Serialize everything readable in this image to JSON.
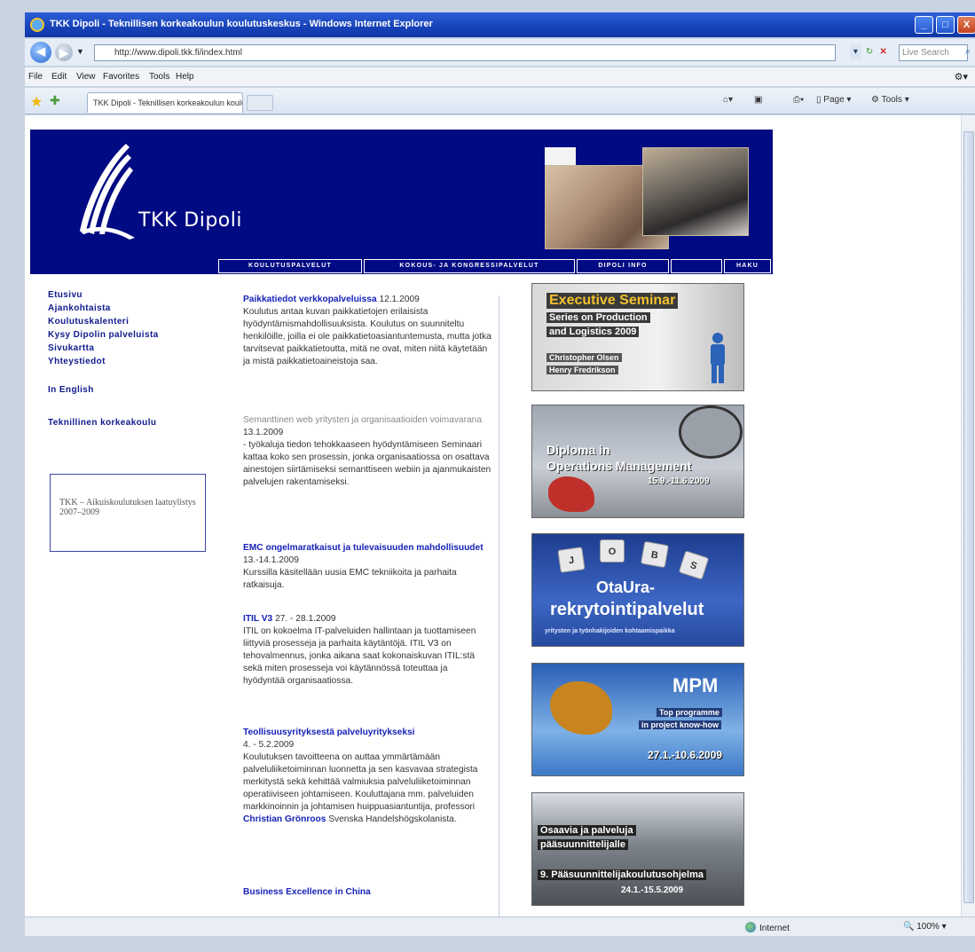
{
  "browser": {
    "window_title": "TKK Dipoli - Teknillisen korkeakoulun koulutuskeskus - Windows Internet Explorer",
    "address": "http://www.dipoli.tkk.fi/index.html",
    "search_placeholder": "Live Search",
    "menu": [
      "File",
      "Edit",
      "View",
      "Favorites",
      "Tools",
      "Help"
    ],
    "tab_title": "TKK Dipoli - Teknillisen korkeakoulun koulutuskeskus",
    "commands": {
      "page": "Page",
      "tools": "Tools"
    },
    "status": {
      "zone": "Internet",
      "zoom": "100%"
    },
    "window_buttons": {
      "min": "_",
      "max": "□",
      "close": "X"
    }
  },
  "site": {
    "logo_text": "TKK Dipoli",
    "nav": [
      "KOULUTUSPALVELUT",
      "KOKOUS- JA KONGRESSIPALVELUT",
      "DIPOLI INFO",
      "",
      "HAKU"
    ],
    "left_links": [
      "Etusivu",
      "Ajankohtaista",
      "Koulutuskalenteri",
      "Kysy Dipolin palveluista",
      "Sivukartta",
      "Yhteystiedot"
    ],
    "english_link": "In English",
    "tkk_link": "Teknillinen korkeakoulu",
    "promo": "TKK – Aikuiskoulutuksen laatuylistys 2007–2009"
  },
  "news": [
    {
      "title": "Paikkatiedot verkkopalveluissa",
      "date": "12.1.2009",
      "body": "Koulutus antaa kuvan paikkatietojen erilaisista hyödyntämismahdollisuuksista. Koulutus on suunniteltu henkilöille, joilla ei ole paikkatietoasiantuntemusta, mutta jotka tarvitsevat paikkatietoutta, mitä ne ovat, miten niitä käytetään ja mistä paikkatietoaineistoja saa."
    },
    {
      "title": "Semanttinen web yritysten ja organisaatioiden voimavarana",
      "date": "13.1.2009",
      "body": "- työkaluja tiedon tehokkaaseen hyödyntämiseen Seminaari kattaa koko sen prosessin, jonka organisaatiossa on osattava ainestojen siirtämiseksi semanttiseen webiin ja ajanmukaisten palvelujen rakentamiseksi."
    },
    {
      "title": "EMC ongelmaratkaisut ja tulevaisuuden mahdollisuudet",
      "date": "13.-14.1.2009",
      "body": "Kurssilla käsitellään uusia EMC tekniikoita ja parhaita ratkaisuja."
    },
    {
      "title": "ITIL V3",
      "date": "27. - 28.1.2009",
      "body": "ITIL on kokoelma IT-palveluiden hallintaan ja tuottamiseen liittyviä prosesseja ja parhaita käytäntöjä. ITIL V3 on tehovalmennus, jonka aikana saat kokonaiskuvan ITIL:stä sekä miten prosesseja voi käytännössä toteuttaa ja hyödyntää organisaatiossa."
    },
    {
      "title": "Teollisuusyrityksestä palveluyritykseksi",
      "date": "4. - 5.2.2009",
      "body_a": "Koulutuksen tavoitteena on auttaa ymmärtämään palveluliiketoiminnan luonnetta ja sen kasvavaa strategista merkitystä sekä kehittää valmiuksia palveluliiketoiminnan operatiiviseen johtamiseen. Kouluttajana mm. palveluiden markkinoinnin ja johtamisen huippuasiantuntija, professori",
      "person": "Christian Grönroos",
      "body_b": "Svenska Handelshögskolanista."
    },
    {
      "title": "Business Excellence in China"
    }
  ],
  "ads": [
    {
      "line1": "Executive Seminar",
      "line2": "Series on Production",
      "line3": "and Logistics 2009",
      "line4": "Christopher Olsen",
      "line5": "Henry Fredrikson"
    },
    {
      "line1": "Diploma in",
      "line2": "Operations Management",
      "line3": "15.9.-11.6.2009"
    },
    {
      "line1": "OtaUra-",
      "line2": "rekrytointipalvelut",
      "line3": "yritysten ja työnhakijoiden kohtaamispaikka",
      "keys": [
        "J",
        "O",
        "B",
        "S"
      ]
    },
    {
      "line1": "MPM",
      "line2": "Top programme",
      "line3": "in project know-how",
      "line4": "27.1.-10.6.2009"
    },
    {
      "line1": "Osaavia ja palveluja",
      "line2": "pääsuunnittelijalle",
      "line3": "9. Pääsuunnittelijakoulutusohjelma",
      "line4": "24.1.-15.5.2009"
    }
  ]
}
